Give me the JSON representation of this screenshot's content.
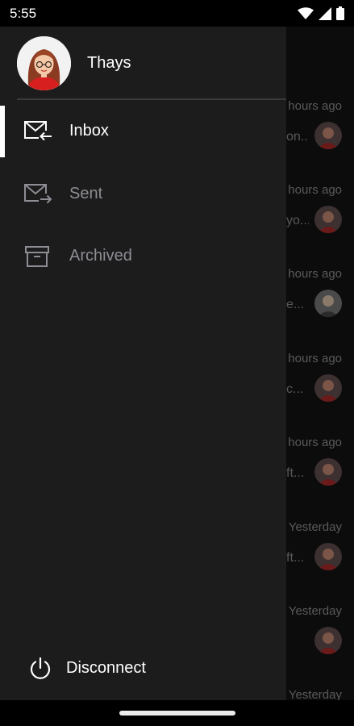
{
  "status_bar": {
    "time": "5:55",
    "icons": [
      "wifi-icon",
      "signal-icon",
      "battery-icon"
    ]
  },
  "drawer": {
    "user_name": "Thays",
    "avatar": "profile-avatar",
    "items": [
      {
        "label": "Inbox",
        "icon": "inbox-icon",
        "active": true
      },
      {
        "label": "Sent",
        "icon": "sent-icon",
        "active": false
      },
      {
        "label": "Archived",
        "icon": "archive-icon",
        "active": false
      }
    ],
    "disconnect_label": "Disconnect"
  },
  "background_list": {
    "items": [
      {
        "time": "hours ago",
        "preview": "on..."
      },
      {
        "time": "hours ago",
        "preview": "yo..."
      },
      {
        "time": "hours ago",
        "preview": "e..."
      },
      {
        "time": "hours ago",
        "preview": "c..."
      },
      {
        "time": "hours ago",
        "preview": "ft..."
      },
      {
        "time": "Yesterday",
        "preview": "ft..."
      },
      {
        "time": "Yesterday",
        "preview": ""
      },
      {
        "time": "Yesterday",
        "preview": ""
      }
    ]
  },
  "colors": {
    "drawer_bg": "#1c1c1c",
    "active_text": "#ffffff",
    "inactive_text": "#8d8d94",
    "avatar_shirt": "#d81f1f"
  }
}
